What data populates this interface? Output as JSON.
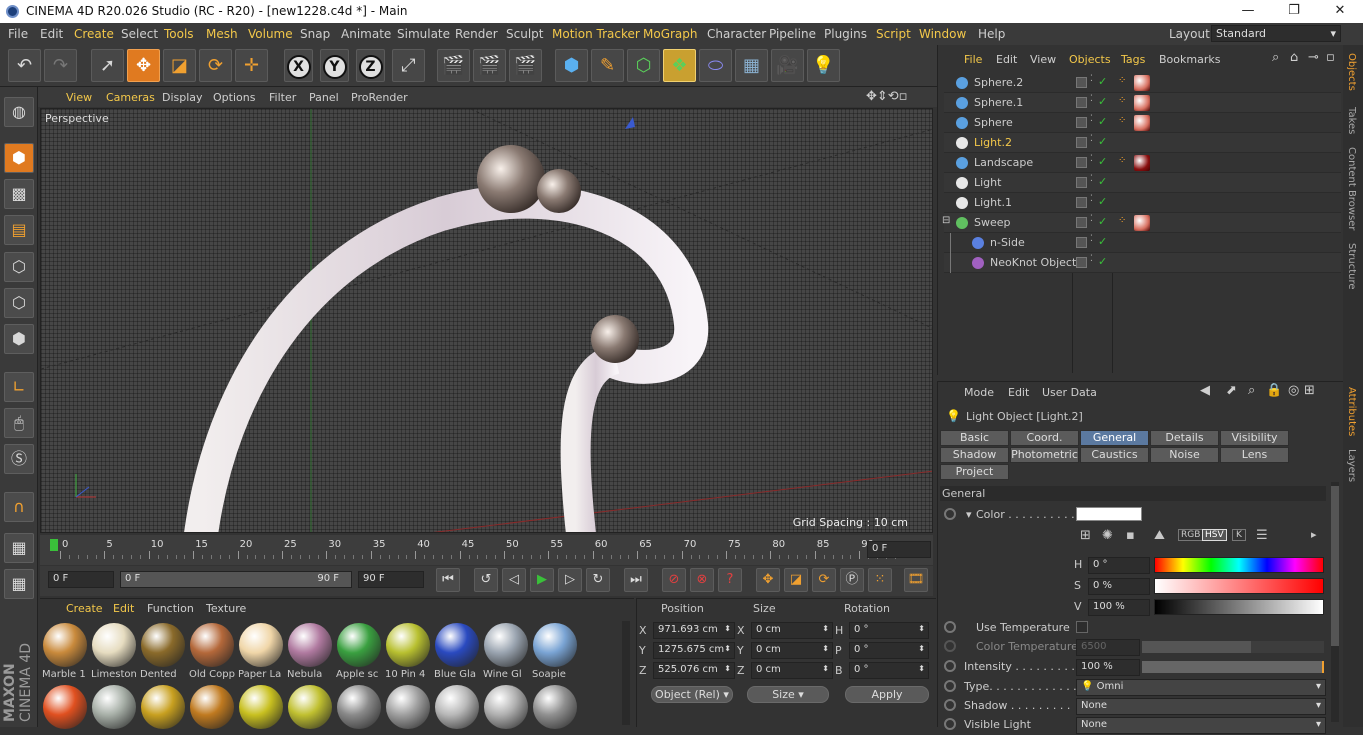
{
  "window": {
    "title": "CINEMA 4D R20.026 Studio (RC - R20) - [new1228.c4d *] - Main"
  },
  "menu": {
    "items": [
      "File",
      "Edit",
      "Create",
      "Select",
      "Tools",
      "Mesh",
      "Volume",
      "Snap",
      "Animate",
      "Simulate",
      "Render",
      "Sculpt",
      "Motion Tracker",
      "MoGraph",
      "Character",
      "Pipeline",
      "Plugins",
      "Script",
      "Window",
      "Help"
    ],
    "layout_label": "Layout:",
    "layout_value": "Standard"
  },
  "viewport": {
    "menu": [
      "View",
      "Cameras",
      "Display",
      "Options",
      "Filter",
      "Panel",
      "ProRender"
    ],
    "camera_label": "Perspective",
    "grid_spacing": "Grid Spacing : 10 cm"
  },
  "timeline": {
    "ticks": [
      "0",
      "5",
      "10",
      "15",
      "20",
      "25",
      "30",
      "35",
      "40",
      "45",
      "50",
      "55",
      "60",
      "65",
      "70",
      "75",
      "80",
      "85",
      "90"
    ],
    "current_frame": "0 F",
    "start_field": "0 F",
    "range_start": "0 F",
    "range_end": "90 F",
    "end_field": "90 F"
  },
  "materials": {
    "menu": [
      "Create",
      "Edit",
      "Function",
      "Texture"
    ],
    "items": [
      {
        "name": "Marble 1",
        "color": "#c98a3c"
      },
      {
        "name": "Limestone",
        "color": "#e6dcc0"
      },
      {
        "name": "Dented",
        "color": "#8a6a2a"
      },
      {
        "name": "Old Copper",
        "color": "#b4683a"
      },
      {
        "name": "Paper La",
        "color": "#f0d6a8"
      },
      {
        "name": "Nebula",
        "color": "#b07aa0"
      },
      {
        "name": "Apple sc",
        "color": "#3aa040"
      },
      {
        "name": "10 Pin 4",
        "color": "#b8c030"
      },
      {
        "name": "Blue Gla",
        "color": "#2a4ac0"
      },
      {
        "name": "Wine Gl",
        "color": "#9aa4b0"
      },
      {
        "name": "Soapie",
        "color": "#7aa4d4"
      }
    ],
    "row2_colors": [
      "#e05020",
      "#a8b0a8",
      "#c8a020",
      "#c07a20",
      "#c8c020",
      "#c0c030",
      "#8a8a8a",
      "#a0a0a0",
      "#b8b8b8",
      "#b0b0b0",
      "#909090"
    ]
  },
  "coords": {
    "headers": {
      "position": "Position",
      "size": "Size",
      "rotation": "Rotation"
    },
    "rows": [
      {
        "axis": "X",
        "pos": "971.693 cm",
        "size_axis": "X",
        "size": "0 cm",
        "rot_axis": "H",
        "rot": "0 °"
      },
      {
        "axis": "Y",
        "pos": "1275.675 cm",
        "size_axis": "Y",
        "size": "0 cm",
        "rot_axis": "P",
        "rot": "0 °"
      },
      {
        "axis": "Z",
        "pos": "525.076 cm",
        "size_axis": "Z",
        "size": "0 cm",
        "rot_axis": "B",
        "rot": "0 °"
      }
    ],
    "mode": "Object (Rel)",
    "size_mode": "Size",
    "apply": "Apply"
  },
  "objects": {
    "menu": [
      "File",
      "Edit",
      "View",
      "Objects",
      "Tags",
      "Bookmarks"
    ],
    "rows": [
      {
        "name": "Sphere.2",
        "icon_color": "#5aa0e0",
        "indent": 0,
        "selected": false,
        "tag": "#d87060"
      },
      {
        "name": "Sphere.1",
        "icon_color": "#5aa0e0",
        "indent": 0,
        "selected": false,
        "tag": "#d87060"
      },
      {
        "name": "Sphere",
        "icon_color": "#5aa0e0",
        "indent": 0,
        "selected": false,
        "tag": "#d87060"
      },
      {
        "name": "Light.2",
        "icon_color": "#e8e8e8",
        "indent": 0,
        "selected": true,
        "tag": ""
      },
      {
        "name": "Landscape",
        "icon_color": "#5aa0e0",
        "indent": 0,
        "selected": false,
        "tag": "#8a1010"
      },
      {
        "name": "Light",
        "icon_color": "#e8e8e8",
        "indent": 0,
        "selected": false,
        "tag": ""
      },
      {
        "name": "Light.1",
        "icon_color": "#e8e8e8",
        "indent": 0,
        "selected": false,
        "tag": ""
      },
      {
        "name": "Sweep",
        "icon_color": "#60c060",
        "indent": 0,
        "selected": false,
        "tag": "#d87060"
      },
      {
        "name": "n-Side",
        "icon_color": "#5a80e0",
        "indent": 1,
        "selected": false,
        "tag": ""
      },
      {
        "name": "NeoKnot Object",
        "icon_color": "#a060c0",
        "indent": 1,
        "selected": false,
        "tag": ""
      }
    ]
  },
  "attributes": {
    "menu": [
      "Mode",
      "Edit",
      "User Data"
    ],
    "object_title": "Light Object [Light.2]",
    "tabs_row1": [
      "Basic",
      "Coord.",
      "General",
      "Details",
      "Visibility"
    ],
    "tabs_row2": [
      "Shadow",
      "Photometric",
      "Caustics",
      "Noise",
      "Lens"
    ],
    "tabs_row3": [
      "Project"
    ],
    "active_tab": "General",
    "section": "General",
    "color_label": "Color . . . . . . . . . .",
    "h_label": "H",
    "h_value": "0 °",
    "s_label": "S",
    "s_value": "0 %",
    "v_label": "V",
    "v_value": "100 %",
    "use_temperature": "Use Temperature",
    "color_temperature": "Color Temperature",
    "temperature_value": "6500",
    "intensity_label": "Intensity . . . . . . . . . .",
    "intensity_value": "100 %",
    "intensity_fraction": 1.0,
    "type_label": "Type. . . . . . . . . . . . .",
    "type_value": "Omni",
    "shadow_label": "Shadow . . . . . . . . .",
    "shadow_value": "None",
    "visible_light_label": "Visible Light",
    "visible_light_value": "None",
    "color_mode_buttons": [
      "RGB",
      "HSV",
      "K"
    ]
  },
  "side_tabs": [
    "Objects",
    "Takes",
    "Content Browser",
    "Structure",
    "Attributes",
    "Layers"
  ],
  "logo": {
    "line1": "MAXON",
    "line2": "CINEMA 4D"
  }
}
